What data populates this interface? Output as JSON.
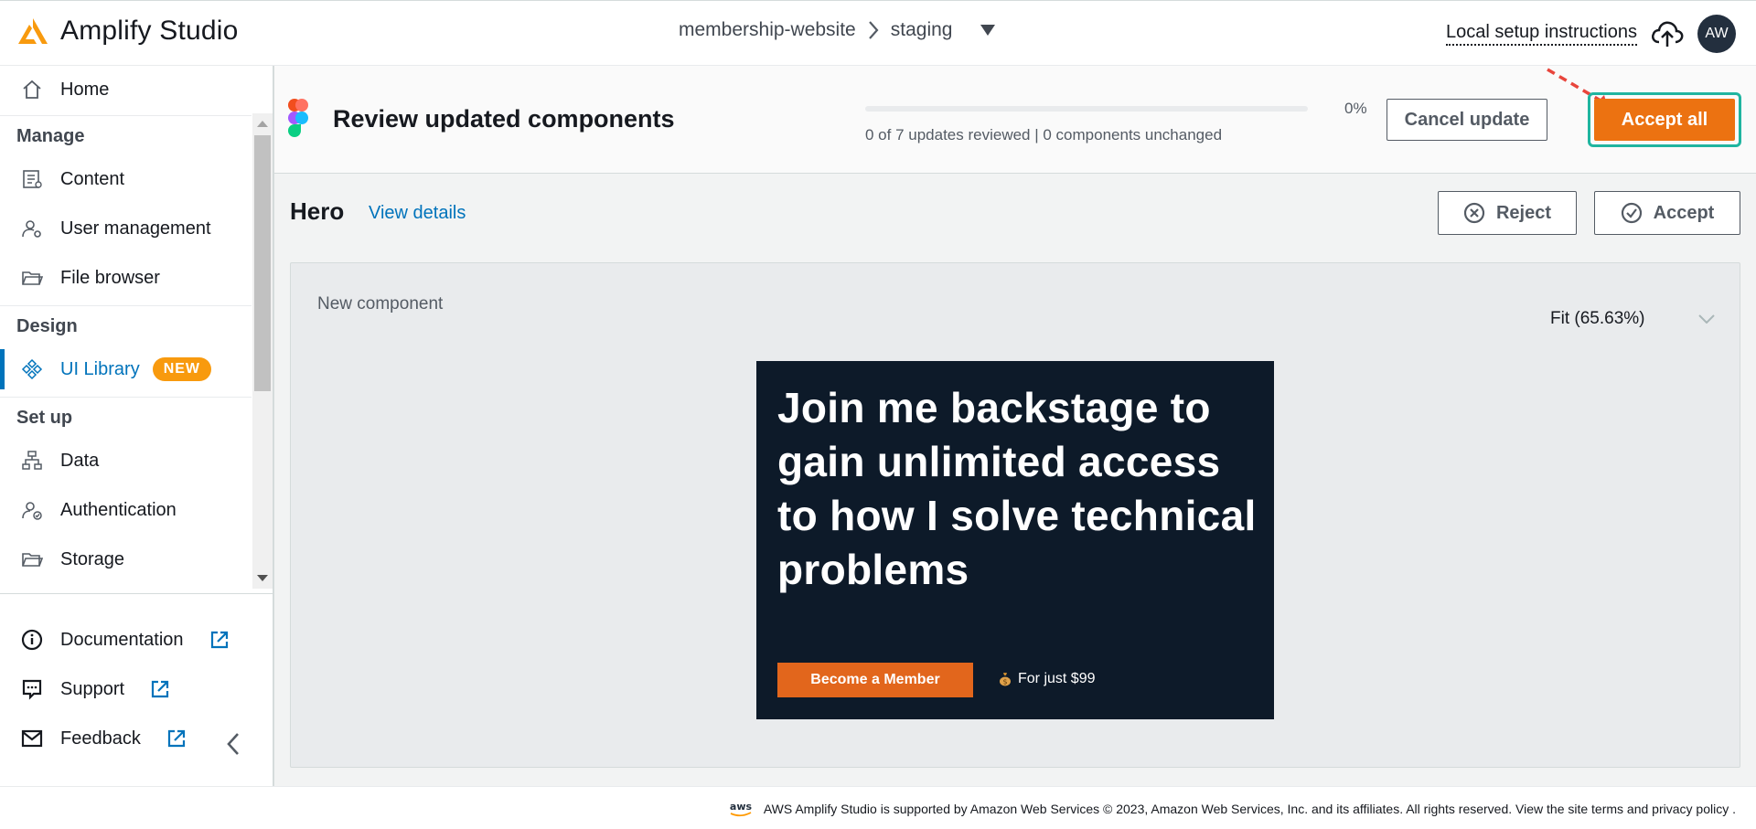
{
  "brand": {
    "name": "Amplify Studio"
  },
  "breadcrumb": {
    "app": "membership-website",
    "env": "staging"
  },
  "topbar": {
    "local_setup": "Local setup instructions",
    "avatar_initials": "AW"
  },
  "sidebar": {
    "home": "Home",
    "manage_title": "Manage",
    "content": "Content",
    "user_management": "User management",
    "file_browser": "File browser",
    "design_title": "Design",
    "ui_library": "UI Library",
    "new_badge": "NEW",
    "setup_title": "Set up",
    "data": "Data",
    "authentication": "Authentication",
    "storage": "Storage",
    "documentation": "Documentation",
    "support": "Support",
    "feedback": "Feedback"
  },
  "review": {
    "title": "Review updated components",
    "progress_text": "0 of 7 updates reviewed | 0 components unchanged",
    "progress_percent_label": "0%",
    "progress_fraction": 0,
    "cancel_label": "Cancel update",
    "accept_all_label": "Accept all"
  },
  "component": {
    "name": "Hero",
    "view_details": "View details",
    "reject_label": "Reject",
    "accept_label": "Accept",
    "preview_label": "New component",
    "zoom_label": "Fit (65.63%)"
  },
  "hero": {
    "heading": "Join me backstage to gain unlimited access to how I solve technical problems",
    "cta": "Become a Member",
    "price": "For just $99"
  },
  "footer": {
    "text": "AWS Amplify Studio is supported by Amazon Web Services © 2023, Amazon Web Services, Inc. and its affiliates. All rights reserved. View the site terms and privacy policy ."
  },
  "colors": {
    "primary_orange": "#ec7211",
    "link_blue": "#0073bb",
    "focus_teal": "#1fb5a0",
    "hero_bg": "#0d1a29"
  }
}
